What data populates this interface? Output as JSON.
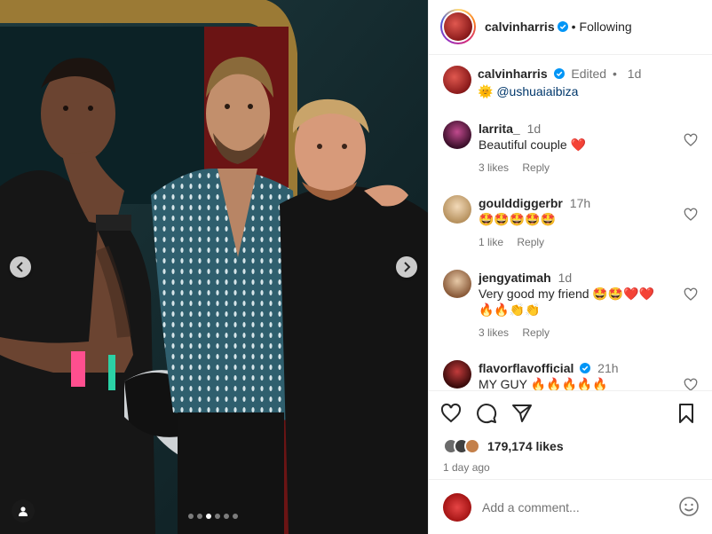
{
  "post": {
    "author": "calvinharris",
    "follow_state": "Following",
    "separator": "•"
  },
  "caption": {
    "username": "calvinharris",
    "edited": "Edited",
    "dot": "•",
    "time": "1d",
    "emoji": "🌞",
    "mention": "@ushuaiaibiza"
  },
  "comments": [
    {
      "username": "larrita_",
      "time": "1d",
      "text": "Beautiful couple ❤️",
      "likes": "3 likes",
      "reply": "Reply",
      "verified": false
    },
    {
      "username": "goulddiggerbr",
      "time": "17h",
      "text": "🤩🤩🤩🤩🤩",
      "likes": "1 like",
      "reply": "Reply",
      "verified": false
    },
    {
      "username": "jengyatimah",
      "time": "1d",
      "text": "Very good my friend 🤩🤩❤️❤️",
      "text2": "🔥🔥👏👏",
      "likes": "3 likes",
      "reply": "Reply",
      "verified": false
    },
    {
      "username": "flavorflavofficial",
      "time": "21h",
      "text": "MY GUY 🔥🔥🔥🔥🔥",
      "verified": true
    }
  ],
  "engagement": {
    "likes": "179,174 likes",
    "ago": "1 day ago"
  },
  "composer": {
    "placeholder": "Add a comment..."
  },
  "carousel": {
    "total": 6,
    "active_index": 2
  },
  "colors": {
    "verified_blue": "#0095f6",
    "heart_red": "#ed4956",
    "muted": "#737373",
    "text": "#262626"
  }
}
